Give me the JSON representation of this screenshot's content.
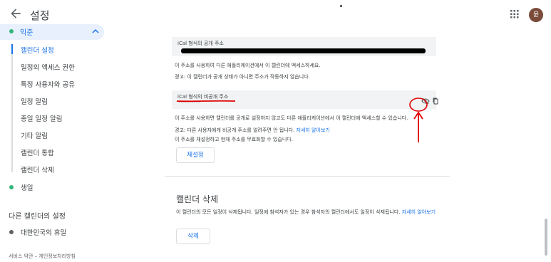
{
  "header": {
    "title": "설정",
    "avatar": "윤"
  },
  "sidebar": {
    "calendar_name": "익준",
    "items": [
      {
        "label": "캘린더 설정"
      },
      {
        "label": "일정의 액세스 권한"
      },
      {
        "label": "특정 사용자와 공유"
      },
      {
        "label": "일정 알림"
      },
      {
        "label": "종일 일정 알림"
      },
      {
        "label": "기타 알림"
      },
      {
        "label": "캘린더 통합"
      },
      {
        "label": "캘린더 삭제"
      }
    ],
    "birthday": "생일",
    "other_heading": "다른 캘린더의 설정",
    "holiday": "대한민국의 휴일",
    "footer": "서비스 약관 – 개인정보처리방침"
  },
  "public_address": {
    "label": "iCal 형식의 공개 주소",
    "note": "이 주소를 사용하여 다른 애플리케이션에서 이 캘린더에 액세스하세요.",
    "warning": "경고: 이 캘린더가 공개 상태가 아니면 주소가 작동하지 않습니다."
  },
  "private_address": {
    "label": "iCal 형식의 비공개 주소",
    "masked_value": "••••••••••",
    "note": "이 주소를 사용하면 캘린더를 공개로 설정하지 않고도 다른 애플리케이션에서 이 캘린더에 액세스할 수 있습니다.",
    "warning": "경고: 다른 사용자에게 비공개 주소를 알려주면 안 됩니다.",
    "learn_more": "자세히 알아보기",
    "reset_note": "이 주소를 재설정하고 현재 주소를 무효화할 수 있습니다.",
    "reset_button": "재설정"
  },
  "delete_section": {
    "title": "캘린더 삭제",
    "description": "이 캘린더의 모든 일정이 삭제됩니다. 일정에 참석자가 있는 경우 참석자의 캘린더에서도 일정이 삭제됩니다.",
    "learn_more": "자세히 알아보기",
    "delete_button": "삭제"
  },
  "colors": {
    "accent": "#1a73e8",
    "annotation": "#e00000",
    "calendar_dot": "#33b679"
  },
  "icons": [
    "back-arrow-icon",
    "apps-grid-icon",
    "chevron-up-icon",
    "eye-off-icon",
    "copy-icon"
  ]
}
